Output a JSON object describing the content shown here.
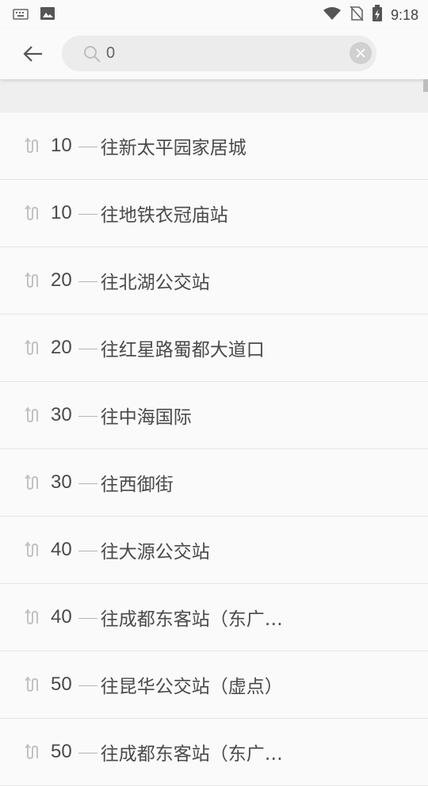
{
  "status_bar": {
    "time": "9:18",
    "icons": [
      "keyboard-icon",
      "image-icon",
      "wifi-icon",
      "no-sim-icon",
      "battery-icon"
    ]
  },
  "search": {
    "value": "0",
    "placeholder": ""
  },
  "routes": [
    {
      "number": "10",
      "destination": "往新太平园家居城"
    },
    {
      "number": "10",
      "destination": "往地铁衣冠庙站"
    },
    {
      "number": "20",
      "destination": "往北湖公交站"
    },
    {
      "number": "20",
      "destination": "往红星路蜀都大道口"
    },
    {
      "number": "30",
      "destination": "往中海国际"
    },
    {
      "number": "30",
      "destination": "往西御街"
    },
    {
      "number": "40",
      "destination": "往大源公交站"
    },
    {
      "number": "40",
      "destination": "往成都东客站（东广…"
    },
    {
      "number": "50",
      "destination": "往昆华公交站（虚点）"
    },
    {
      "number": "50",
      "destination": "往成都东客站（东广…"
    }
  ],
  "colors": {
    "background": "#fafafa",
    "text": "#4a4a4a",
    "search_bg": "#ececec"
  }
}
